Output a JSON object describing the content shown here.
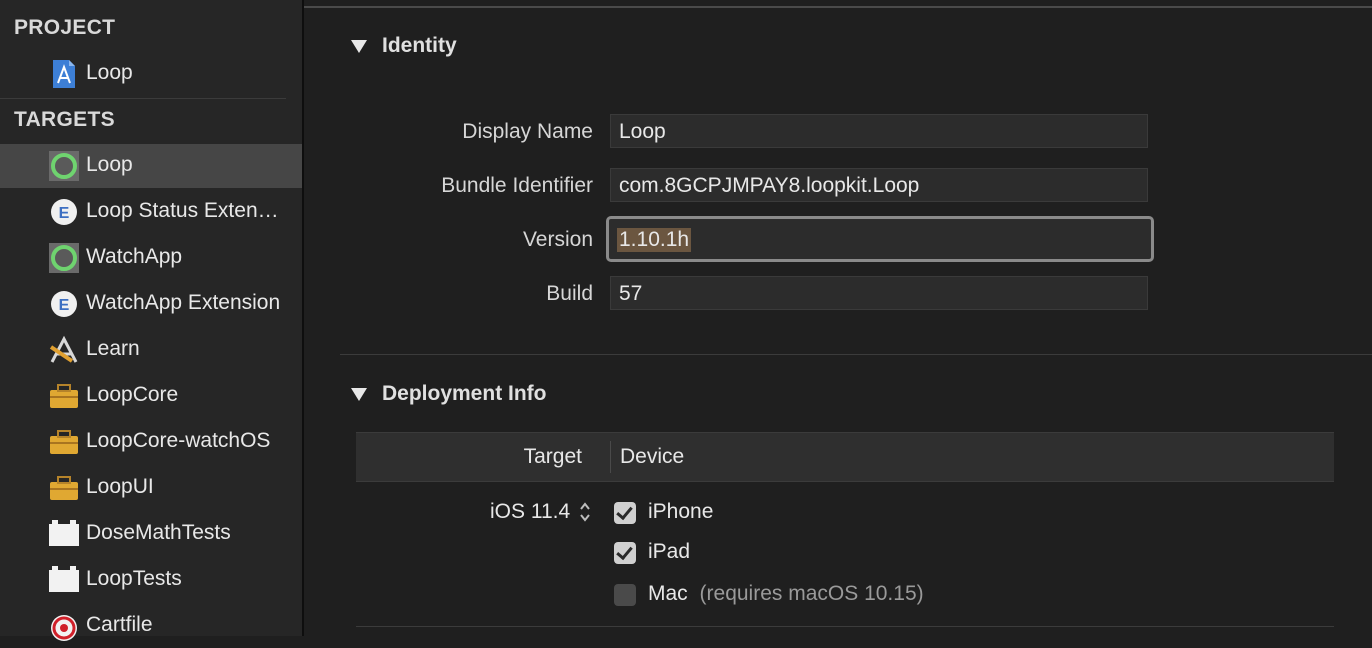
{
  "sidebar": {
    "project_header": "PROJECT",
    "project_item": {
      "label": "Loop",
      "icon": "xcode-project-icon"
    },
    "targets_header": "TARGETS",
    "targets": [
      {
        "label": "Loop",
        "icon": "app-target-icon",
        "selected": true
      },
      {
        "label": "Loop Status Exten…",
        "icon": "extension-icon"
      },
      {
        "label": "WatchApp",
        "icon": "app-target-icon"
      },
      {
        "label": "WatchApp Extension",
        "icon": "extension-icon"
      },
      {
        "label": "Learn",
        "icon": "app-tool-icon"
      },
      {
        "label": "LoopCore",
        "icon": "framework-toolbox-icon"
      },
      {
        "label": "LoopCore-watchOS",
        "icon": "framework-toolbox-icon"
      },
      {
        "label": "LoopUI",
        "icon": "framework-toolbox-icon"
      },
      {
        "label": "DoseMathTests",
        "icon": "test-bundle-icon"
      },
      {
        "label": "LoopTests",
        "icon": "test-bundle-icon"
      },
      {
        "label": "Cartfile",
        "icon": "target-bullseye-icon"
      }
    ]
  },
  "identity": {
    "title": "Identity",
    "display_name_label": "Display Name",
    "display_name_value": "Loop",
    "bundle_id_label": "Bundle Identifier",
    "bundle_id_value": "com.8GCPJMPAY8.loopkit.Loop",
    "version_label": "Version",
    "version_value": "1.10.1h",
    "build_label": "Build",
    "build_value": "57"
  },
  "deployment": {
    "title": "Deployment Info",
    "col_target": "Target",
    "col_device": "Device",
    "ios_version": "iOS 11.4",
    "devices": [
      {
        "label": "iPhone",
        "checked": true,
        "note": ""
      },
      {
        "label": "iPad",
        "checked": true,
        "note": ""
      },
      {
        "label": "Mac",
        "checked": false,
        "note": "(requires macOS 10.15)"
      }
    ]
  },
  "colors": {
    "background": "#1f1f1f",
    "selection": "#464646",
    "text_selection": "#6b5640"
  }
}
